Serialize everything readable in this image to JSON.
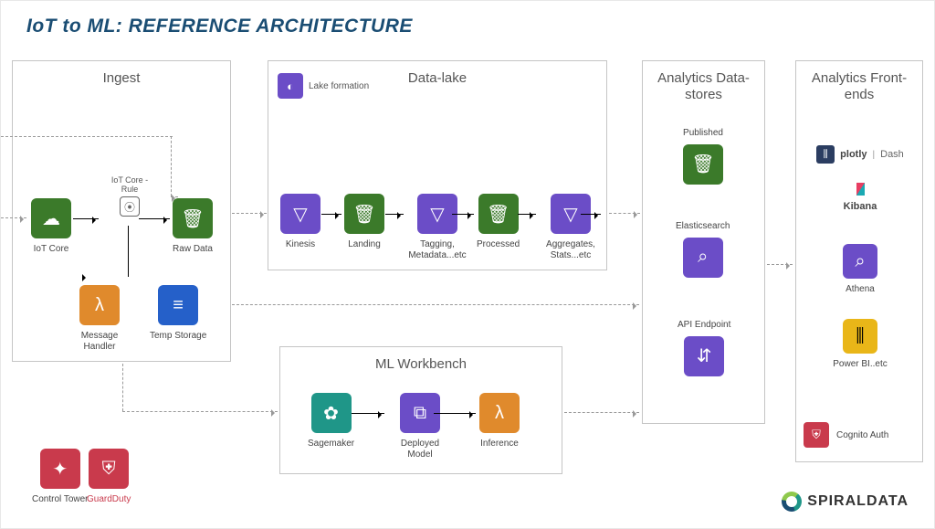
{
  "title": "IoT to ML: REFERENCE ARCHITECTURE",
  "panels": {
    "ingest": "Ingest",
    "datalake": "Data-lake",
    "mlwb": "ML Workbench",
    "datastores": "Analytics Data-stores",
    "frontends": "Analytics Front-ends"
  },
  "ingest": {
    "iot_core": "IoT Core",
    "rule": "IoT Core - Rule",
    "raw_data": "Raw Data",
    "message_handler": "Message Handler",
    "temp_storage": "Temp Storage"
  },
  "datalake": {
    "lake_formation": "Lake formation",
    "kinesis": "Kinesis",
    "landing": "Landing",
    "tagging": "Tagging, Metadata...etc",
    "processed": "Processed",
    "aggregates": "Aggregates, Stats...etc"
  },
  "mlwb": {
    "sagemaker": "Sagemaker",
    "deployed_model": "Deployed Model",
    "inference": "Inference"
  },
  "datastores": {
    "published": "Published",
    "elasticsearch": "Elasticsearch",
    "api_endpoint": "API Endpoint"
  },
  "frontends": {
    "plotly": "plotly",
    "dash": "Dash",
    "kibana": "Kibana",
    "athena": "Athena",
    "powerbi": "Power BI..etc",
    "cognito": "Cognito Auth"
  },
  "footer": {
    "control_tower": "Control Tower",
    "guardduty": "GuardDuty"
  },
  "branding": "SPIRALDATA"
}
